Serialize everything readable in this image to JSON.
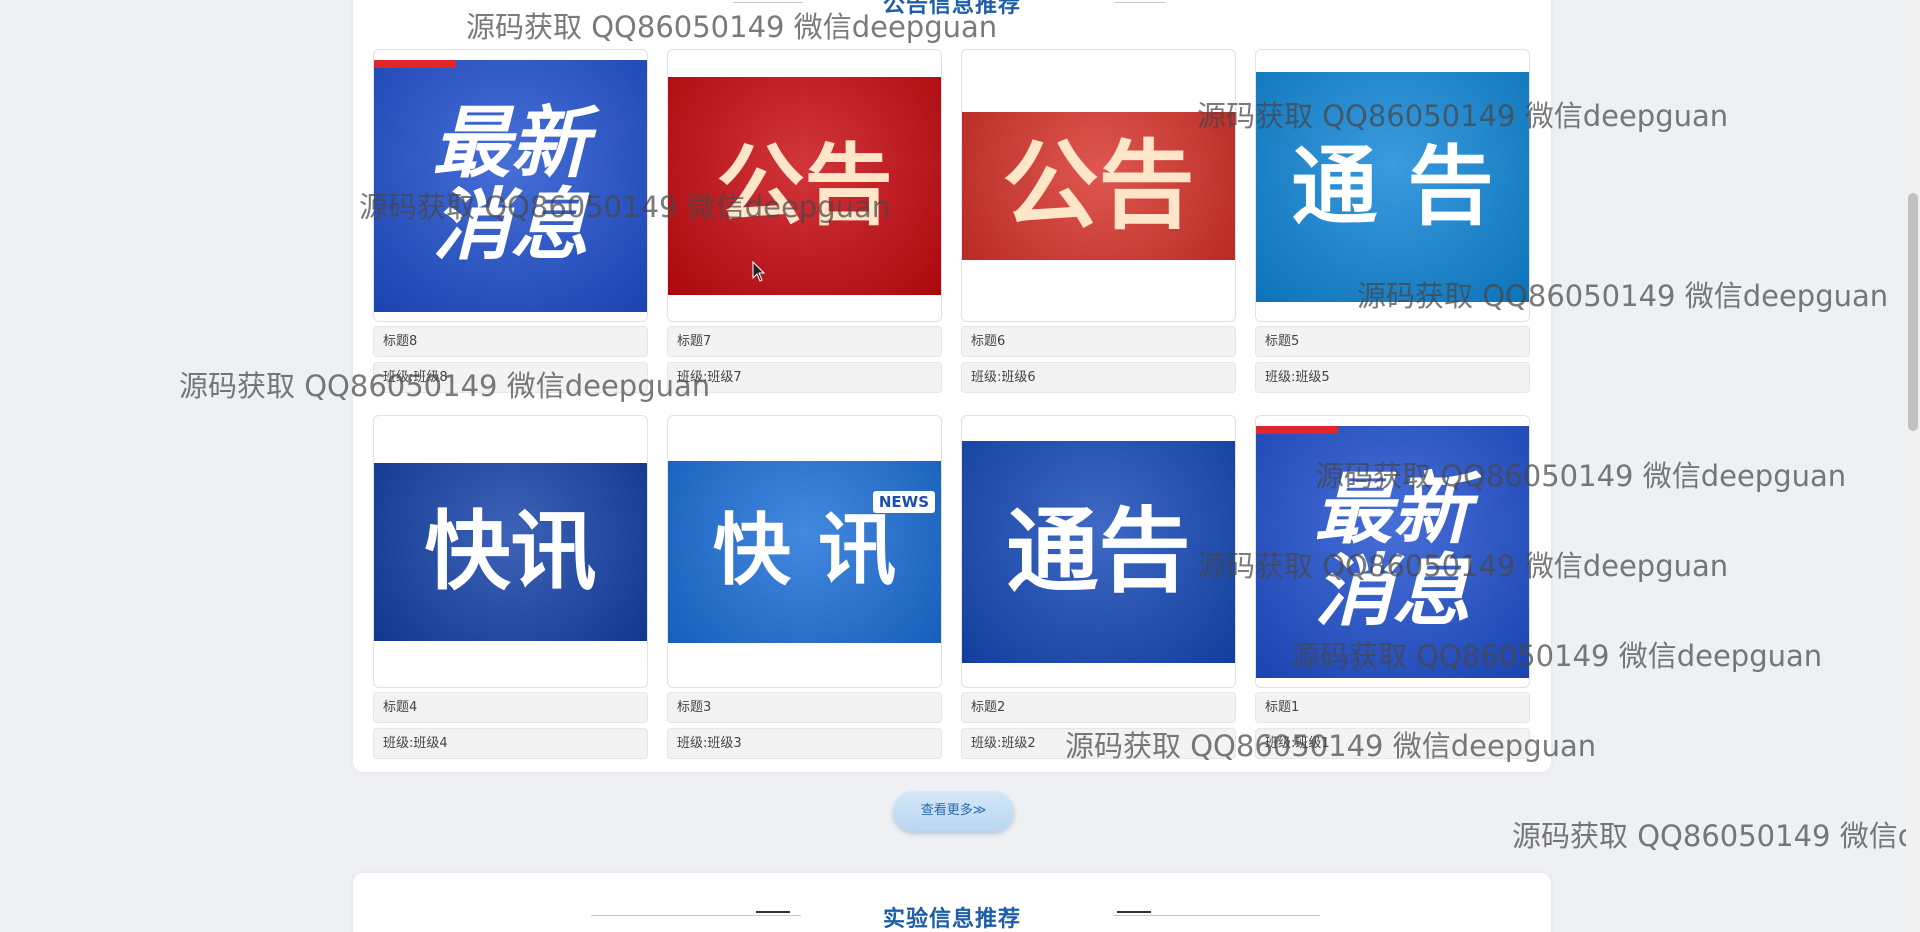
{
  "section_top": {
    "title": "公告信息推荐"
  },
  "section_bottom": {
    "title": "实验信息推荐"
  },
  "cards": [
    {
      "title": "标题8",
      "class_label": "班级:班级8",
      "poster_text": "最新\n消息",
      "poster_bg": "#1f4fcf"
    },
    {
      "title": "标题7",
      "class_label": "班级:班级7",
      "poster_text": "公告",
      "poster_bg": "#c8090f"
    },
    {
      "title": "标题6",
      "class_label": "班级:班级6",
      "poster_text": "公告",
      "poster_bg": "#d8322a"
    },
    {
      "title": "标题5",
      "class_label": "班级:班级5",
      "poster_text": "通 告",
      "poster_bg": "#0f86d8"
    },
    {
      "title": "标题4",
      "class_label": "班级:班级4",
      "poster_text": "快讯",
      "poster_bg": "#1340a8"
    },
    {
      "title": "标题3",
      "class_label": "班级:班级3",
      "poster_text": "快 讯",
      "poster_bg": "#1b6fd9"
    },
    {
      "title": "标题2",
      "class_label": "班级:班级2",
      "poster_text": "通告",
      "poster_bg": "#1448b8"
    },
    {
      "title": "标题1",
      "class_label": "班级:班级1",
      "poster_text": "最新\n消息",
      "poster_bg": "#1f4fcf"
    }
  ],
  "more_button": {
    "label": "查看更多≫"
  },
  "watermark_text": "源码获取 QQ86050149 微信deepguan",
  "watermark_text_cut": "源码获取 QQ86050149 微信d",
  "colors": {
    "accent": "#1d5ea8",
    "button": "#c8dff4"
  }
}
